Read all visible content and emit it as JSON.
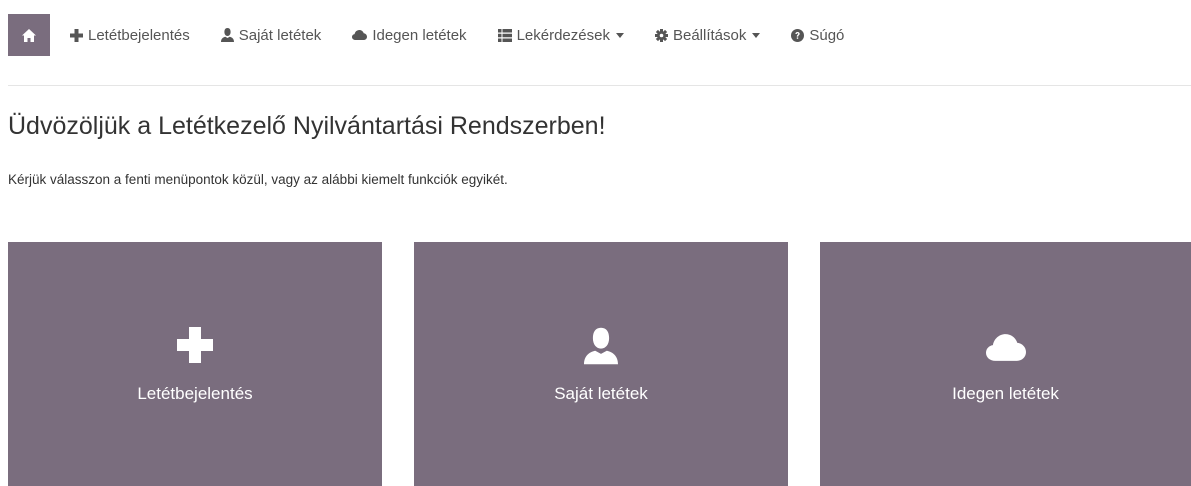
{
  "nav": {
    "home_icon": "home-icon",
    "items": [
      {
        "label": "Letétbejelentés",
        "icon": "plus-icon"
      },
      {
        "label": "Saját letétek",
        "icon": "user-icon"
      },
      {
        "label": "Idegen letétek",
        "icon": "cloud-icon"
      },
      {
        "label": "Lekérdezések",
        "icon": "list-icon",
        "dropdown": true
      },
      {
        "label": "Beállítások",
        "icon": "gear-icon",
        "dropdown": true
      },
      {
        "label": "Súgó",
        "icon": "question-icon"
      }
    ]
  },
  "main": {
    "title": "Üdvözöljük a Letétkezelő Nyilvántartási Rendszerben!",
    "intro": "Kérjük válasszon a fenti menüpontok közül, vagy az alábbi kiemelt funkciók egyikét."
  },
  "tiles": [
    {
      "label": "Letétbejelentés",
      "icon": "plus-icon"
    },
    {
      "label": "Saját letétek",
      "icon": "user-icon"
    },
    {
      "label": "Idegen letétek",
      "icon": "cloud-icon"
    }
  ],
  "colors": {
    "accent": "#7a6d7e",
    "nav_text": "#555555",
    "tile_text": "#ffffff"
  }
}
